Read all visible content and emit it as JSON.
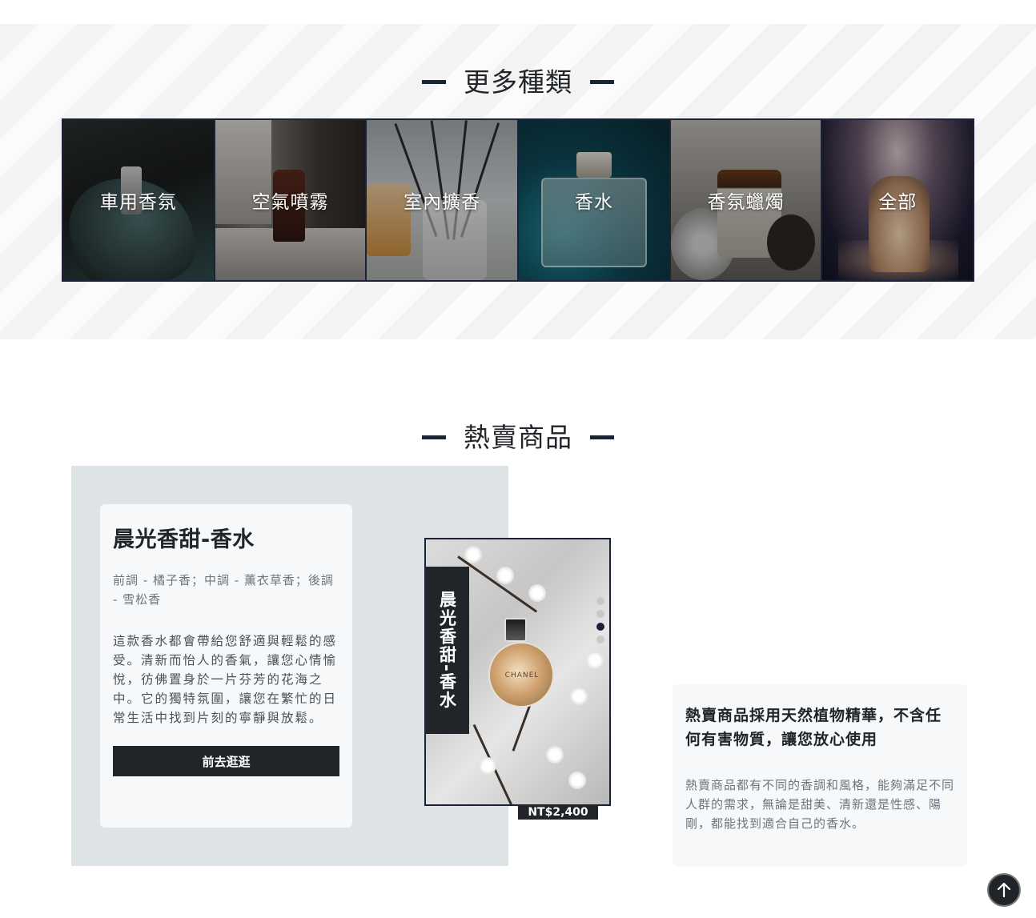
{
  "categories_section": {
    "title": "更多種類",
    "items": [
      {
        "label": "車用香氛"
      },
      {
        "label": "空氣噴霧"
      },
      {
        "label": "室內擴香"
      },
      {
        "label": "香水"
      },
      {
        "label": "香氛蠟燭"
      },
      {
        "label": "全部"
      }
    ]
  },
  "hot_section": {
    "title": "熱賣商品",
    "product": {
      "name": "晨光香甜-香水",
      "notes": "前調 - 橘子香；中調 - 薰衣草香；後調 - 雪松香",
      "description": "這款香水都會帶給您舒適與輕鬆的感受。清新而怡人的香氣，讓您心情愉悅，彷佛置身於一片芬芳的花海之中。它的獨特氛圍，讓您在繁忙的日常生活中找到片刻的寧靜與放鬆。",
      "button_label": "前去逛逛",
      "vertical_label": "晨光香甜-香水",
      "price": "NT$2,400",
      "bottle_brand": "CHANEL"
    },
    "carousel": {
      "count": 4,
      "active_index": 2
    },
    "feature": {
      "heading": "熱賣商品採用天然植物精華，不含任何有害物質，讓您放心使用",
      "body": "熱賣商品都有不同的香調和風格，能夠滿足不同人群的需求，無論是甜美、清新還是性感、陽剛，都能找到適合自己的香水。"
    }
  },
  "back_to_top": {
    "icon": "arrow-up-icon"
  }
}
